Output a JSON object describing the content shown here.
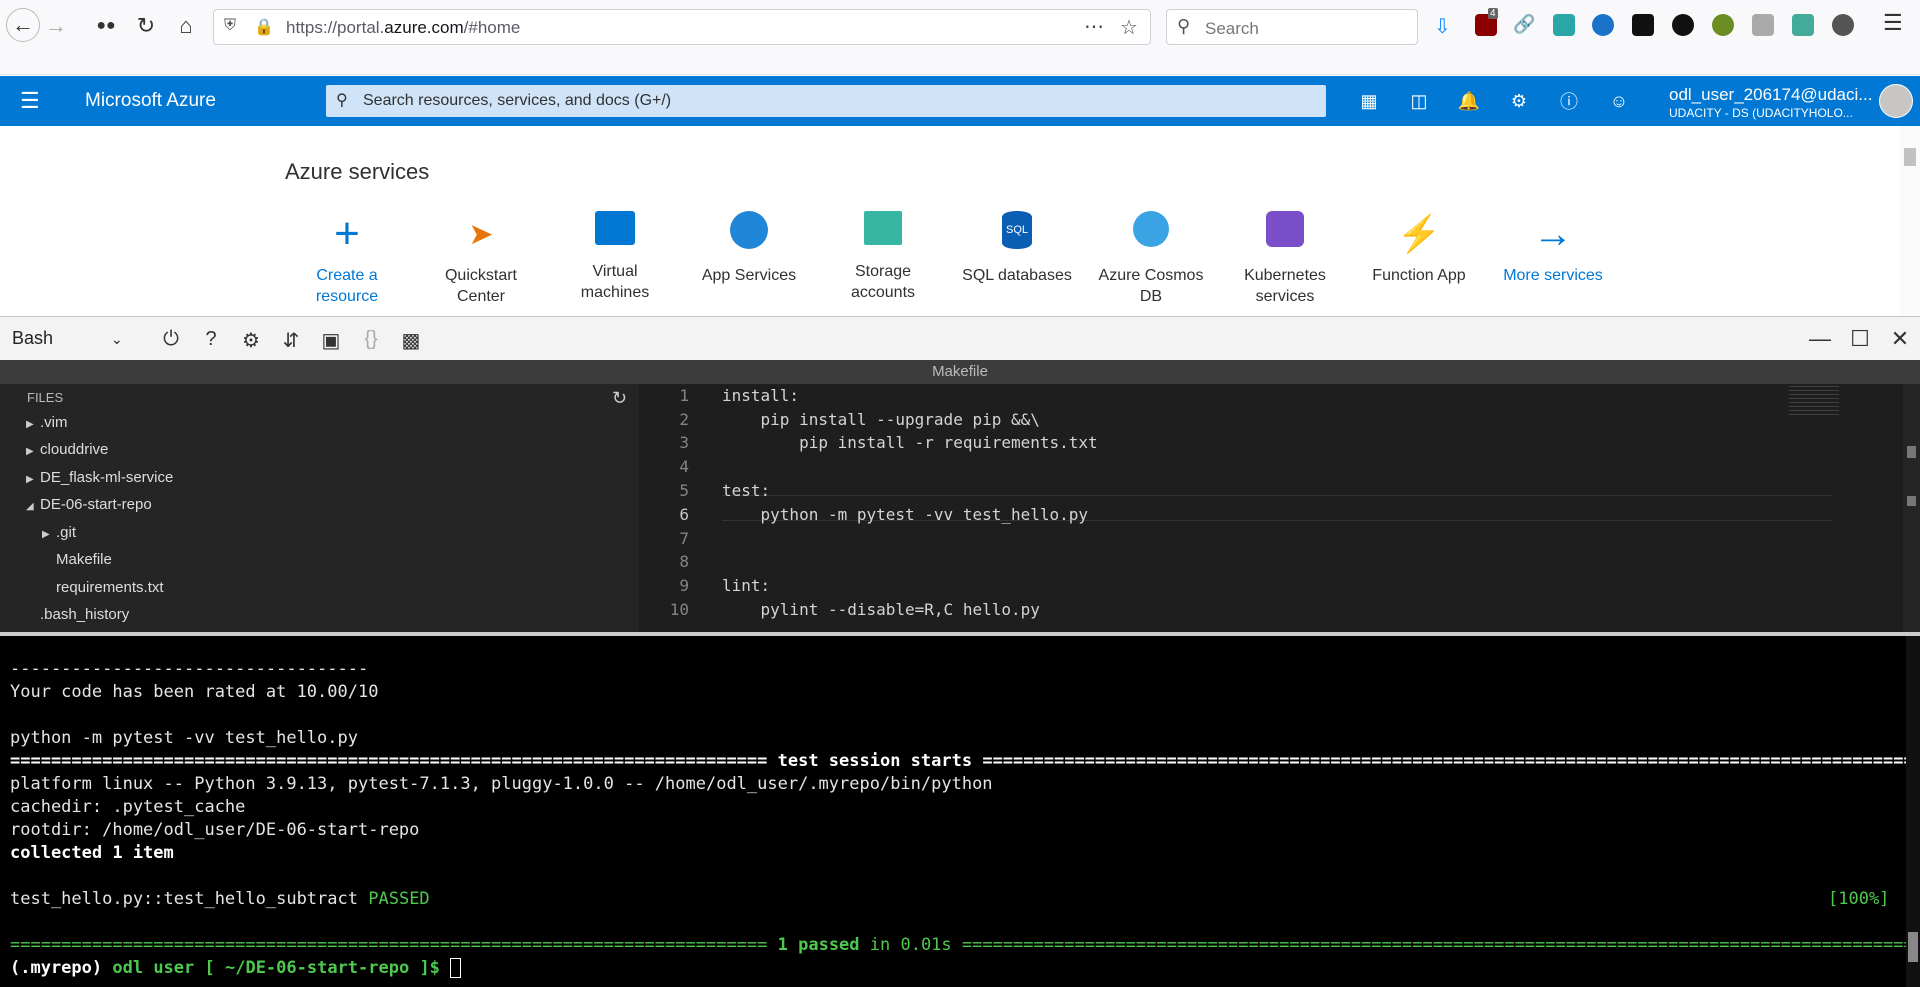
{
  "browser": {
    "url_prefix": "https://portal.",
    "url_domain": "azure.com",
    "url_suffix": "/#home",
    "search_placeholder": "Search",
    "badges": {
      "ublock": "4"
    }
  },
  "azure": {
    "brand": "Microsoft Azure",
    "search_placeholder": "Search resources, services, and docs (G+/)",
    "user_name": "odl_user_206174@udaci...",
    "user_org": "UDACITY - DS (UDACITYHOLO..."
  },
  "services": {
    "title": "Azure services",
    "items": [
      {
        "line1": "Create a",
        "line2": "resource",
        "icon": "plus-icon",
        "link": true
      },
      {
        "line1": "Quickstart",
        "line2": "Center",
        "icon": "rocket-icon",
        "link": false
      },
      {
        "line1": "Virtual",
        "line2": "machines",
        "icon": "monitor-icon",
        "link": false
      },
      {
        "line1": "App Services",
        "line2": "",
        "icon": "globe-icon",
        "link": false
      },
      {
        "line1": "Storage",
        "line2": "accounts",
        "icon": "storage-icon",
        "link": false
      },
      {
        "line1": "SQL databases",
        "line2": "",
        "icon": "sql-icon",
        "link": false
      },
      {
        "line1": "Azure Cosmos",
        "line2": "DB",
        "icon": "planet-icon",
        "link": false
      },
      {
        "line1": "Kubernetes",
        "line2": "services",
        "icon": "cubes-icon",
        "link": false
      },
      {
        "line1": "Function App",
        "line2": "",
        "icon": "lightning-icon",
        "link": false
      },
      {
        "line1": "More services",
        "line2": "",
        "icon": "arrow-right-icon",
        "link": true
      }
    ]
  },
  "shell": {
    "shell_type": "Bash"
  },
  "editor": {
    "file_title": "Makefile",
    "files_header": "FILES",
    "tree": [
      {
        "label": ".vim",
        "expanded": false,
        "folder": true
      },
      {
        "label": "clouddrive",
        "expanded": false,
        "folder": true
      },
      {
        "label": "DE_flask-ml-service",
        "expanded": false,
        "folder": true
      },
      {
        "label": "DE-06-start-repo",
        "expanded": true,
        "folder": true
      },
      {
        "label": ".git",
        "expanded": false,
        "folder": true
      },
      {
        "label": "Makefile",
        "folder": false
      },
      {
        "label": "requirements.txt",
        "folder": false
      },
      {
        "label": ".bash_history",
        "folder": false
      }
    ],
    "lines": [
      {
        "n": "1",
        "text": "install:"
      },
      {
        "n": "2",
        "text": "    pip install --upgrade pip &&\\"
      },
      {
        "n": "3",
        "text": "        pip install -r requirements.txt"
      },
      {
        "n": "4",
        "text": ""
      },
      {
        "n": "5",
        "text": "test:"
      },
      {
        "n": "6",
        "text": "    python -m pytest -vv test_hello.py"
      },
      {
        "n": "7",
        "text": ""
      },
      {
        "n": "8",
        "text": ""
      },
      {
        "n": "9",
        "text": "lint:"
      },
      {
        "n": "10",
        "text": "    pylint --disable=R,C hello.py"
      }
    ]
  },
  "terminal": {
    "dashes": "-----------------------------------",
    "rating": "Your code has been rated at 10.00/10",
    "cmd": "python -m pytest -vv test_hello.py",
    "session_left": "==========================================================================",
    "session_label": " test session starts ",
    "session_right": "==========================================================================================================================",
    "platform": "platform linux -- Python 3.9.13, pytest-7.1.3, pluggy-1.0.0 -- /home/odl_user/.myrepo/bin/python",
    "cachedir": "cachedir: .pytest_cache",
    "rootdir": "rootdir: /home/odl_user/DE-06-start-repo",
    "collected": "collected 1 item",
    "test_name": "test_hello.py::test_hello_subtract",
    "test_status": "PASSED",
    "test_pct": "[100%]",
    "result_left": "==========================================================================",
    "result_passed": "1 passed",
    "result_time": " in 0.01s ",
    "result_right": "======================================================================================================================",
    "prompt_env": "(.myrepo)",
    "prompt_user": "odl user",
    "prompt_path": "[ ~/DE-06-start-repo ]$"
  }
}
